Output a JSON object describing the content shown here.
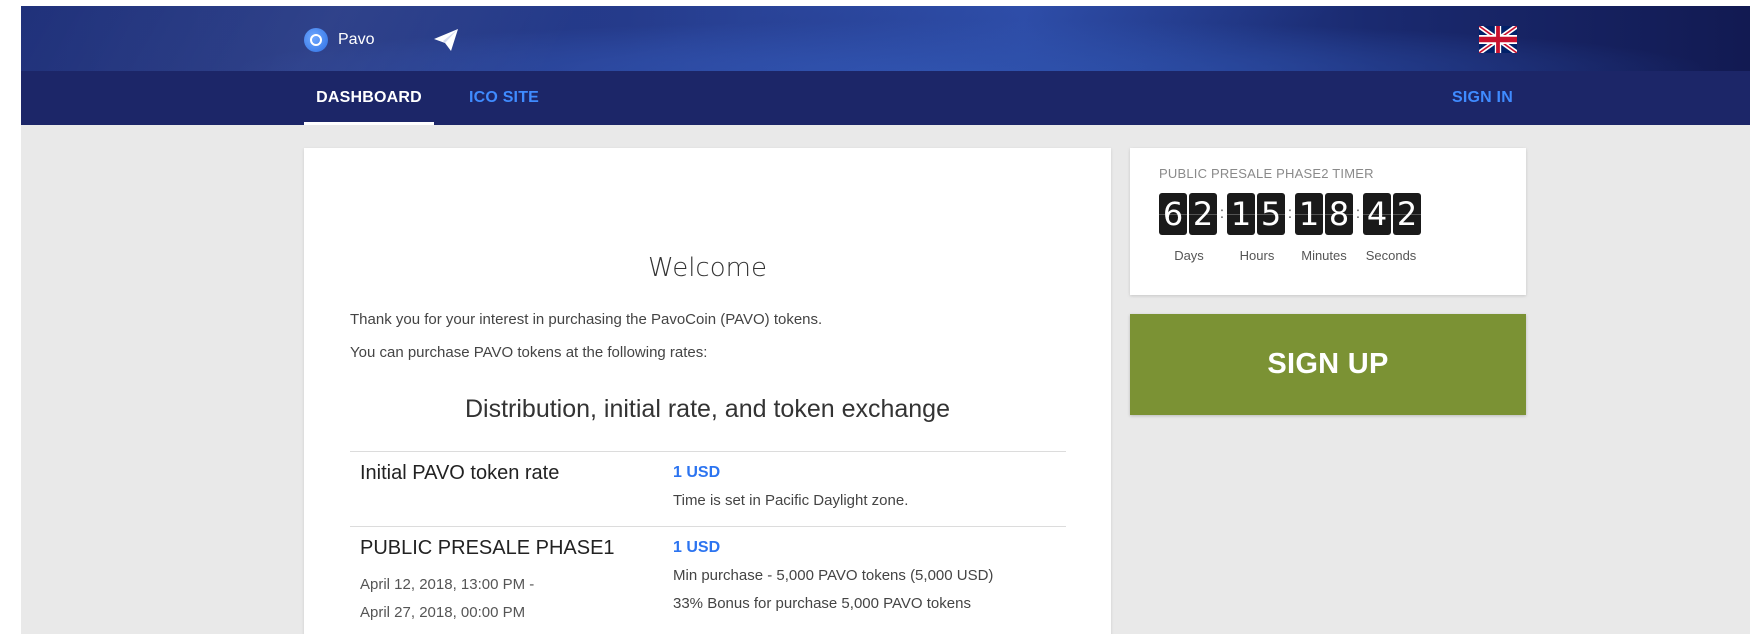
{
  "header": {
    "brand_name": "Pavo",
    "icons": [
      "pavo-logo-icon",
      "telegram-icon",
      "uk-flag-icon"
    ]
  },
  "nav": {
    "tabs": [
      {
        "label": "DASHBOARD",
        "active": true
      },
      {
        "label": "ICO SITE",
        "active": false
      }
    ],
    "signin_label": "SIGN IN"
  },
  "main": {
    "welcome_title": "Welcome",
    "intro_line1": "Thank you for your interest in purchasing the PavoCoin (PAVO) tokens.",
    "intro_line2": "You can purchase PAVO tokens at the following rates:",
    "distribution_title": "Distribution, initial rate, and token exchange",
    "rates": [
      {
        "name": "Initial PAVO token rate",
        "value": "1 USD",
        "notes": [
          "Time is set in Pacific Daylight zone."
        ]
      },
      {
        "name": "PUBLIC PRESALE PHASE1",
        "date_start": "April 12, 2018, 13:00 PM -",
        "date_end": "April 27, 2018, 00:00 PM",
        "value": "1 USD",
        "notes": [
          "Min purchase - 5,000 PAVO tokens (5,000 USD)",
          "33% Bonus for purchase 5,000 PAVO tokens"
        ]
      }
    ]
  },
  "timer": {
    "title": "PUBLIC PRESALE PHASE2 TIMER",
    "days": [
      "6",
      "2"
    ],
    "hours": [
      "1",
      "5"
    ],
    "minutes": [
      "1",
      "8"
    ],
    "seconds": [
      "4",
      "2"
    ],
    "labels": {
      "days": "Days",
      "hours": "Hours",
      "minutes": "Minutes",
      "seconds": "Seconds"
    }
  },
  "signup": {
    "label": "SIGN UP",
    "color": "#7b9234"
  },
  "colors": {
    "nav_bg": "#1c2668",
    "link_blue": "#3f8bff",
    "rate_blue": "#2c74f0"
  }
}
